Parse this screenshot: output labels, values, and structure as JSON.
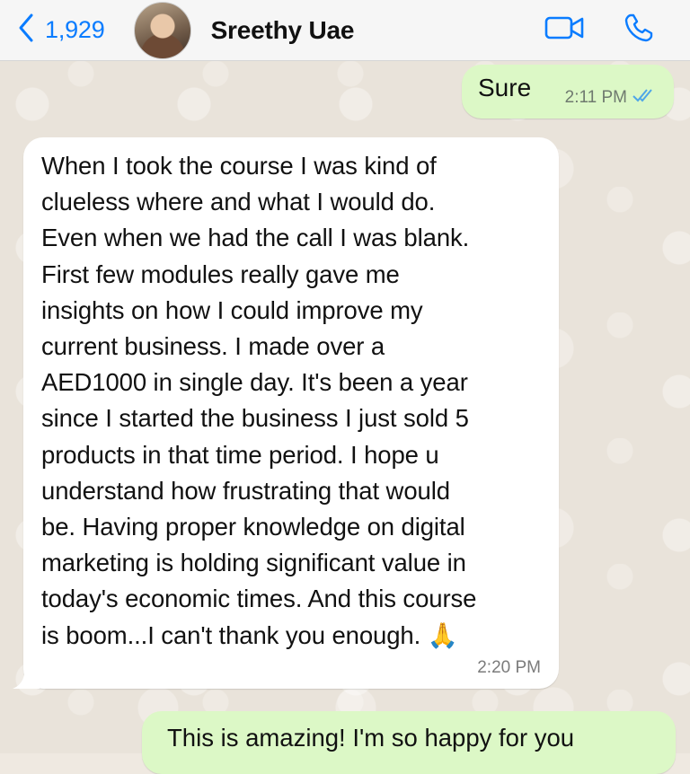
{
  "header": {
    "back_count": "1,929",
    "contact_name": "Sreethy Uae",
    "accent_color": "#0a7cff",
    "icons": [
      "chevron-left-icon",
      "video-camera-icon",
      "phone-icon"
    ]
  },
  "messages": [
    {
      "direction": "outgoing",
      "text": "Sure",
      "time": "2:11 PM",
      "status": "read"
    },
    {
      "direction": "incoming",
      "text": "When I took the course I was kind of\nclueless where and what I would do.\nEven when we had the call I was blank.\nFirst few modules really gave me\ninsights on how I could improve my\ncurrent business. I made over a\nAED1000 in single day. It's been a year\nsince I started the business I just sold 5\nproducts in that time period. I hope u\nunderstand how frustrating that would\nbe. Having proper knowledge on digital\nmarketing is holding significant value in\ntoday's economic times. And this course\nis boom...I can't thank you enough. 🙏",
      "time": "2:20 PM"
    },
    {
      "direction": "outgoing",
      "text": "This is amazing! I'm so happy for you"
    }
  ],
  "colors": {
    "outgoing_bubble": "#dcf8c6",
    "incoming_bubble": "#ffffff",
    "chat_background": "#e9e3da"
  }
}
